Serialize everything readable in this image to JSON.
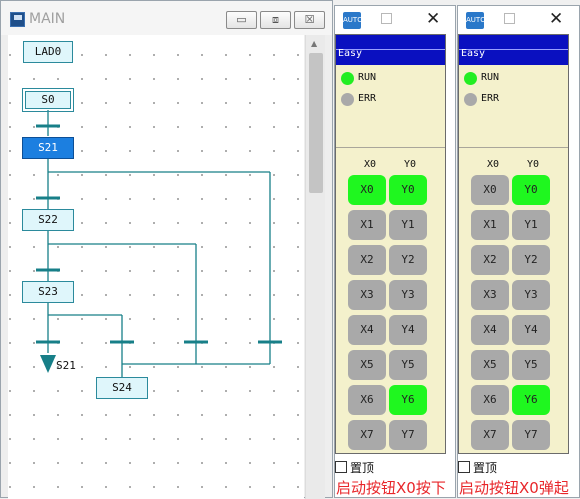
{
  "main_window": {
    "title": "MAIN",
    "minimize_glyph": "▭",
    "restore_glyph": "⧈",
    "close_glyph": "☒"
  },
  "ladder": {
    "header_block": "LAD0",
    "blocks": [
      "S0",
      "S21",
      "S22",
      "S23",
      "S24"
    ],
    "jump_label": "S21",
    "active_block": "S21"
  },
  "device_windows": [
    {
      "icon_text": "AUTO",
      "close_glyph": "✕",
      "header": "Easy",
      "leds": [
        {
          "label": "RUN",
          "color": "#22ee22"
        },
        {
          "label": "ERR",
          "color": "#a9a9a9"
        }
      ],
      "col_headers": [
        "X0",
        "Y0"
      ],
      "inputs": [
        {
          "label": "X0",
          "on": true
        },
        {
          "label": "X1",
          "on": false
        },
        {
          "label": "X2",
          "on": false
        },
        {
          "label": "X3",
          "on": false
        },
        {
          "label": "X4",
          "on": false
        },
        {
          "label": "X5",
          "on": false
        },
        {
          "label": "X6",
          "on": false
        },
        {
          "label": "X7",
          "on": false
        }
      ],
      "outputs": [
        {
          "label": "Y0",
          "on": true
        },
        {
          "label": "Y1",
          "on": false
        },
        {
          "label": "Y2",
          "on": false
        },
        {
          "label": "Y3",
          "on": false
        },
        {
          "label": "Y4",
          "on": false
        },
        {
          "label": "Y5",
          "on": false
        },
        {
          "label": "Y6",
          "on": true
        },
        {
          "label": "Y7",
          "on": false
        }
      ],
      "topmost_label": "置顶",
      "caption": "启动按钮X0按下"
    },
    {
      "icon_text": "AUTO",
      "close_glyph": "✕",
      "header": "Easy",
      "leds": [
        {
          "label": "RUN",
          "color": "#22ee22"
        },
        {
          "label": "ERR",
          "color": "#a9a9a9"
        }
      ],
      "col_headers": [
        "X0",
        "Y0"
      ],
      "inputs": [
        {
          "label": "X0",
          "on": false
        },
        {
          "label": "X1",
          "on": false
        },
        {
          "label": "X2",
          "on": false
        },
        {
          "label": "X3",
          "on": false
        },
        {
          "label": "X4",
          "on": false
        },
        {
          "label": "X5",
          "on": false
        },
        {
          "label": "X6",
          "on": false
        },
        {
          "label": "X7",
          "on": false
        }
      ],
      "outputs": [
        {
          "label": "Y0",
          "on": true
        },
        {
          "label": "Y1",
          "on": false
        },
        {
          "label": "Y2",
          "on": false
        },
        {
          "label": "Y3",
          "on": false
        },
        {
          "label": "Y4",
          "on": false
        },
        {
          "label": "Y5",
          "on": false
        },
        {
          "label": "Y6",
          "on": true
        },
        {
          "label": "Y7",
          "on": false
        }
      ],
      "topmost_label": "置顶",
      "caption": "启动按钮X0弹起"
    }
  ],
  "colors": {
    "on": "#1ff71f",
    "off": "#a9a9a9",
    "header_blue": "#0a10c0",
    "panel": "#f4f1cc",
    "caption": "#e8262a",
    "active_step": "#1c7fe0",
    "wire": "#177f88"
  }
}
